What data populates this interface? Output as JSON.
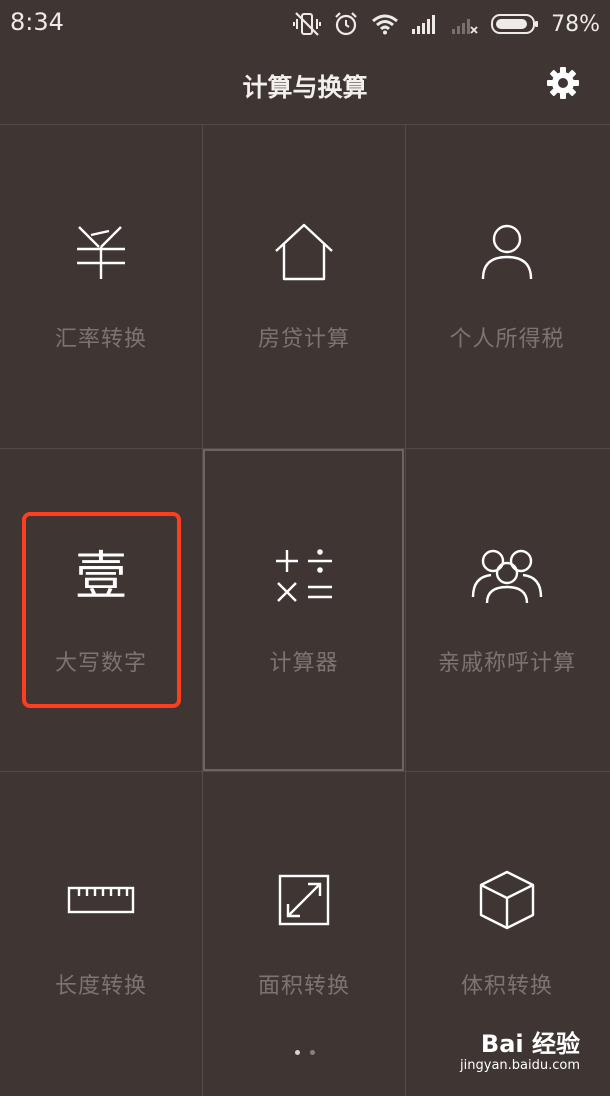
{
  "status_bar": {
    "time": "8:34",
    "battery_percent": "78%",
    "icons": [
      "vibrate-off-icon",
      "alarm-icon",
      "wifi-icon",
      "signal-icon",
      "signal-empty-icon",
      "battery-icon"
    ]
  },
  "header": {
    "title": "计算与换算",
    "settings_icon": "gear-icon"
  },
  "grid": {
    "items": [
      {
        "label": "汇率转换",
        "icon": "yen-icon"
      },
      {
        "label": "房贷计算",
        "icon": "house-icon"
      },
      {
        "label": "个人所得税",
        "icon": "person-icon"
      },
      {
        "label": "大写数字",
        "icon": "chinese-numeral-icon",
        "icon_text": "壹"
      },
      {
        "label": "计算器",
        "icon": "calculator-icon"
      },
      {
        "label": "亲戚称呼计算",
        "icon": "family-icon"
      },
      {
        "label": "长度转换",
        "icon": "ruler-icon"
      },
      {
        "label": "面积转换",
        "icon": "area-icon"
      },
      {
        "label": "体积转换",
        "icon": "cube-icon"
      }
    ]
  },
  "pagination": {
    "pages": 2,
    "current": 1
  },
  "watermark": {
    "logo": "Bai 经验",
    "url": "jingyan.baidu.com"
  },
  "colors": {
    "background": "#3f3633",
    "grid_line": "#544a47",
    "label": "#7d7471",
    "icon": "#ffffff",
    "highlight_annotation": "#ff3d1f"
  }
}
